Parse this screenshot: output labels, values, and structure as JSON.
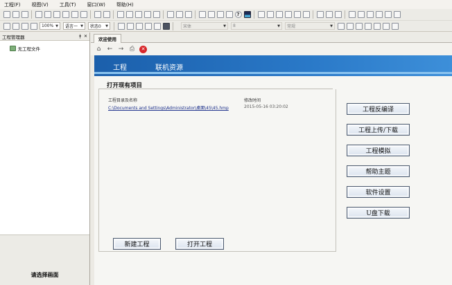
{
  "menu": [
    "工程(F)",
    "视图(V)",
    "工具(T)",
    "窗口(W)",
    "帮助(H)"
  ],
  "toolbar": {
    "zoom": "100%",
    "language": "语言一",
    "state": "状态0",
    "font_name": "宋体",
    "font_size": "8",
    "style": "常规",
    "help_glyph": "?"
  },
  "project_manager": {
    "title": "工程管理器",
    "pin": "ǂ",
    "close": "✕",
    "tree_item": "无工程文件",
    "select_screen": "请选择画面"
  },
  "tab": {
    "label": "欢迎使用"
  },
  "banner": {
    "tab1": "工程",
    "tab2": "联机资源"
  },
  "open_project": {
    "title": "打开现有项目",
    "col_dir": "工程目录及名称",
    "col_time": "修改时间",
    "row_path": "C:\\Documents and Settings\\Administrator\\桌面\\45\\45.hmp",
    "row_time": "2015-05-16 03:20:02",
    "new_btn": "新建工程",
    "open_btn": "打开工程"
  },
  "side_buttons": [
    "工程反编译",
    "工程上传/下载",
    "工程模拟",
    "帮助主题",
    "软件设置",
    "U盘下载"
  ],
  "colors": {
    "banner_blue": "#1b5fab",
    "stop_red": "#d8262a"
  }
}
